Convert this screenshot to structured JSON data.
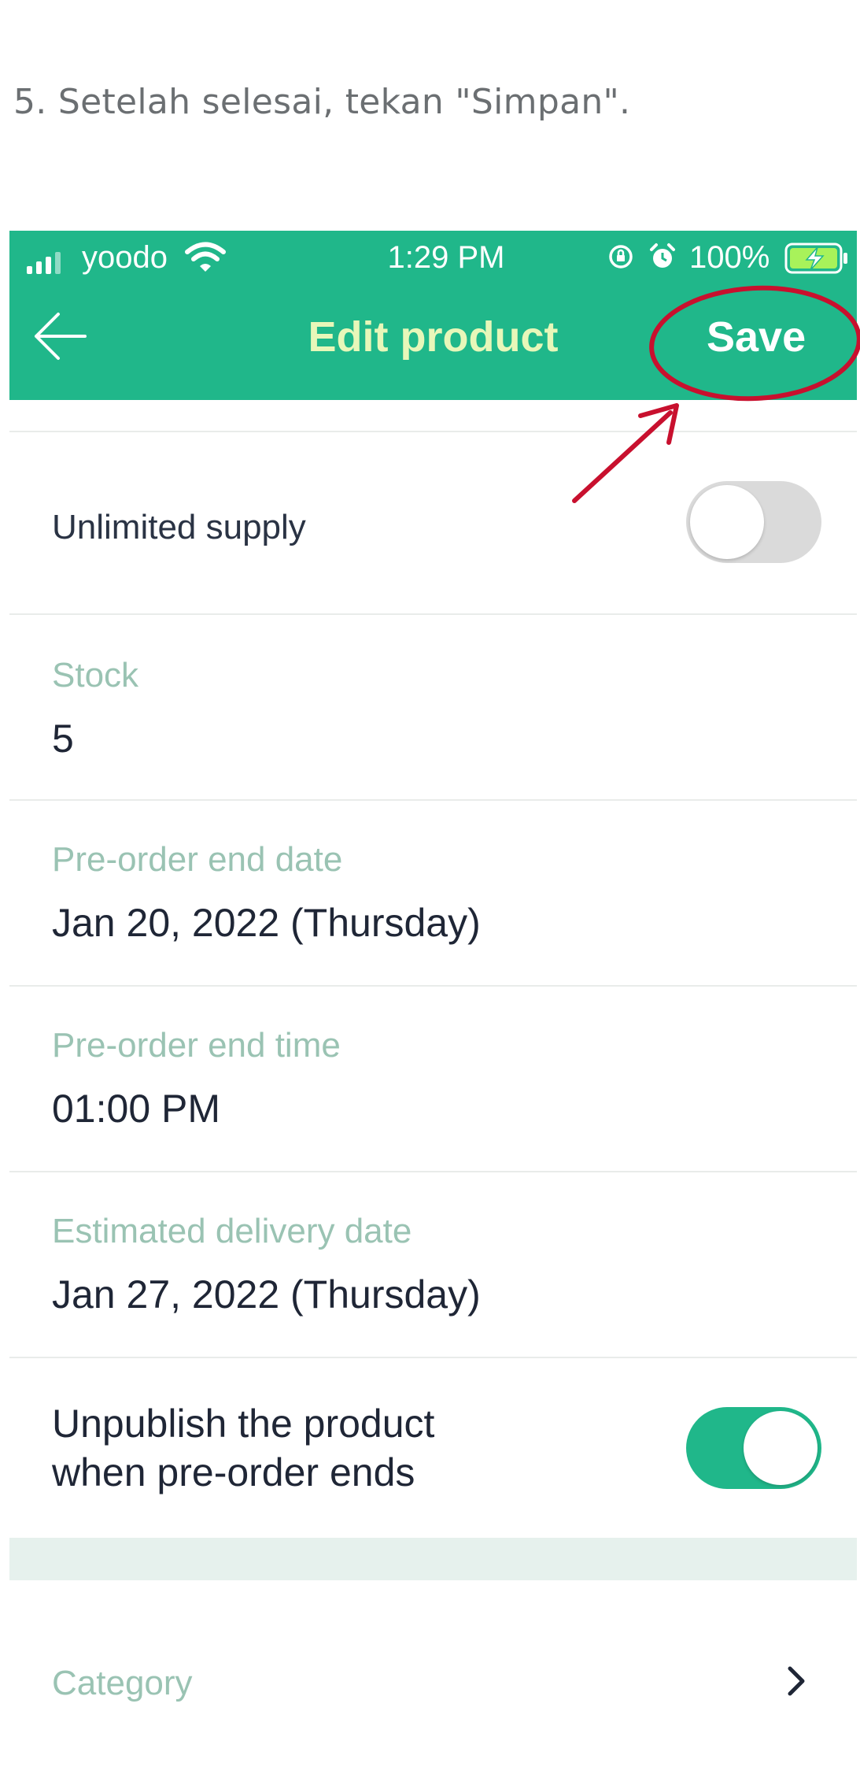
{
  "instruction": "5. Setelah selesai, tekan \"Simpan\".",
  "status_bar": {
    "carrier": "yoodo",
    "time": "1:29 PM",
    "battery_percent": "100%",
    "icons": [
      "signal-icon",
      "wifi-icon",
      "rotation-lock-icon",
      "alarm-icon",
      "battery-charging-icon"
    ]
  },
  "header": {
    "title": "Edit product",
    "save_label": "Save",
    "back_icon": "back-arrow-icon",
    "background_color": "#20b78a",
    "annotation": "red circle around Save with red arrow pointing to it"
  },
  "form": {
    "unlimited_supply": {
      "label": "Unlimited supply",
      "enabled": false
    },
    "stock": {
      "label": "Stock",
      "value": "5"
    },
    "preorder_end_date": {
      "label": "Pre-order end date",
      "value": "Jan 20, 2022 (Thursday)"
    },
    "preorder_end_time": {
      "label": "Pre-order end time",
      "value": "01:00 PM"
    },
    "estimated_delivery_date": {
      "label": "Estimated delivery date",
      "value": "Jan 27, 2022 (Thursday)"
    },
    "unpublish": {
      "label_line1": "Unpublish the product",
      "label_line2": "when pre-order ends",
      "enabled": true
    },
    "category": {
      "label": "Category",
      "icon": "chevron-right-icon"
    }
  }
}
